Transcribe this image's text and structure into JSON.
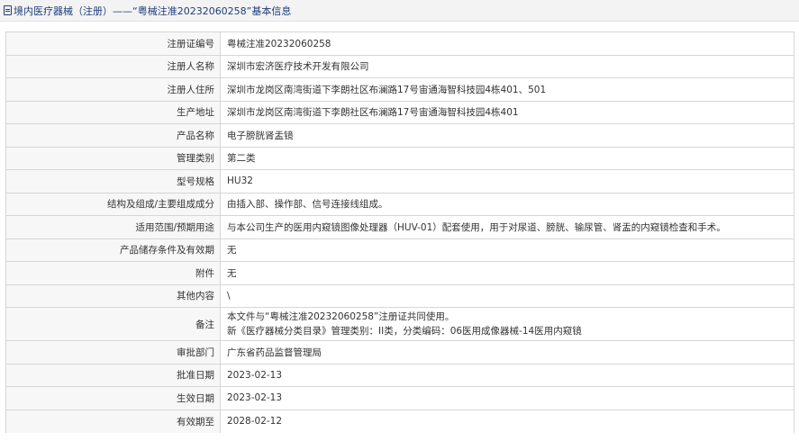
{
  "header": {
    "title": "境内医疗器械（注册）——“粤械注准20232060258”基本信息"
  },
  "fields": [
    {
      "label": "注册证编号",
      "value": "粤械注准20232060258"
    },
    {
      "label": "注册人名称",
      "value": "深圳市宏济医疗技术开发有限公司"
    },
    {
      "label": "注册人住所",
      "value": "深圳市龙岗区南湾街道下李朗社区布澜路17号宙通海智科技园4栋401、501"
    },
    {
      "label": "生产地址",
      "value": "深圳市龙岗区南湾街道下李朗社区布澜路17号宙通海智科技园4栋401"
    },
    {
      "label": "产品名称",
      "value": "电子膀胱肾盂镜"
    },
    {
      "label": "管理类别",
      "value": "第二类"
    },
    {
      "label": "型号规格",
      "value": "HU32"
    },
    {
      "label": "结构及组成/主要组成成分",
      "value": "由插入部、操作部、信号连接线组成。"
    },
    {
      "label": "适用范围/预期用途",
      "value": "与本公司生产的医用内窥镜图像处理器（HUV-01）配套使用，用于对尿道、膀胱、输尿管、肾盂的内窥镜检查和手术。"
    },
    {
      "label": "产品储存条件及有效期",
      "value": "无"
    },
    {
      "label": "附件",
      "value": "无"
    },
    {
      "label": "其他内容",
      "value": "\\"
    },
    {
      "label": "备注",
      "lines": [
        "本文件与“粤械注准20232060258”注册证共同使用。",
        "新《医疗器械分类目录》管理类别：II类，分类编码：06医用成像器械-14医用内窥镜"
      ]
    },
    {
      "label": "审批部门",
      "value": "广东省药品监督管理局"
    },
    {
      "label": "批准日期",
      "value": "2023-02-13"
    },
    {
      "label": "生效日期",
      "value": "2023-02-13"
    },
    {
      "label": "有效期至",
      "value": "2028-02-12"
    }
  ]
}
